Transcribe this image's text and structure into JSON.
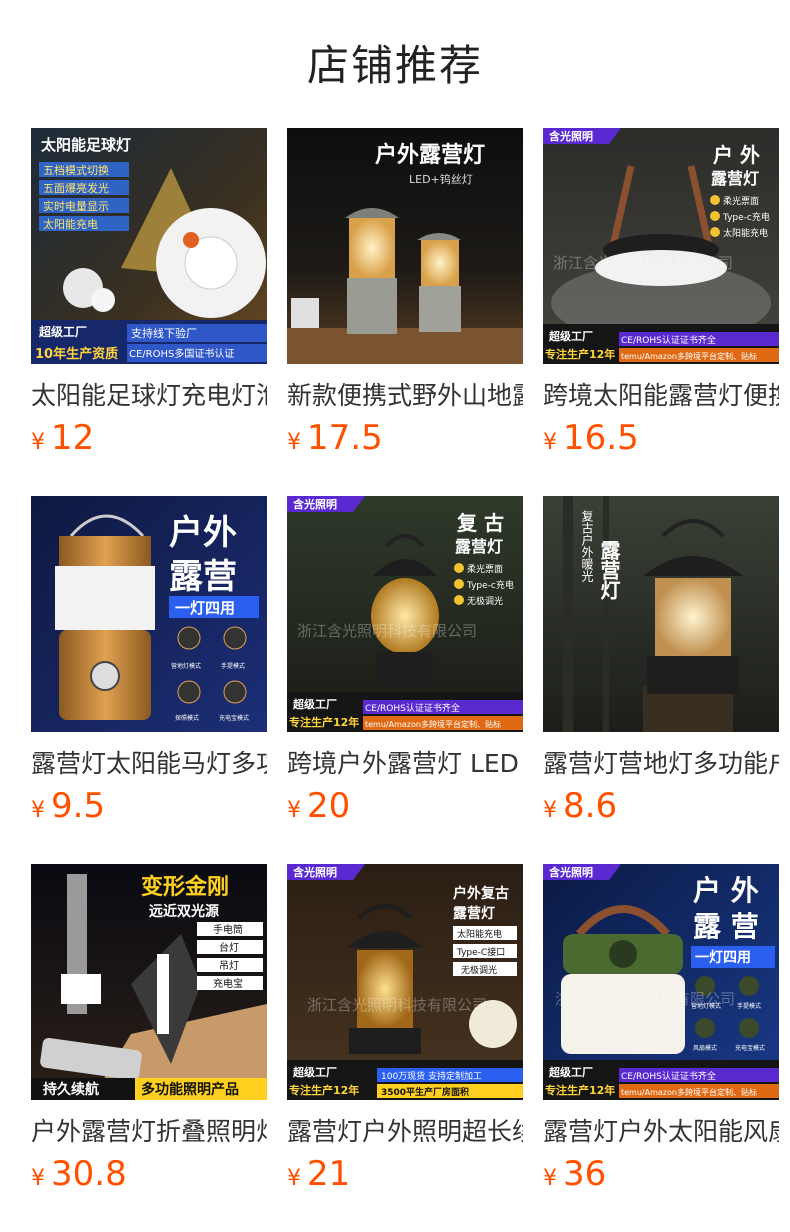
{
  "header": {
    "title": "店铺推荐"
  },
  "colors": {
    "price": "#ff5000",
    "title": "#222222",
    "name": "#333333"
  },
  "products": [
    {
      "name": "太阳能足球灯充电灯泡",
      "currency": "¥",
      "price": "12",
      "image_text": {
        "headline": "太阳能足球灯",
        "bullets": [
          "五档模式切换",
          "五面爆亮发光",
          "实时电量显示",
          "太阳能充电"
        ],
        "badge": "超级工厂",
        "years": "10年生产资质",
        "sub1": "支持线下验厂",
        "sub2": "CE/ROHS多国证书认证"
      }
    },
    {
      "name": "新款便携式野外山地露营灯",
      "currency": "¥",
      "price": "17.5",
      "image_text": {
        "headline": "户外露营灯",
        "sub": "LED+钨丝灯"
      }
    },
    {
      "name": "跨境太阳能露营灯便携式",
      "currency": "¥",
      "price": "16.5",
      "image_text": {
        "brand": "含光照明",
        "headline1": "户 外",
        "headline2": "露营灯",
        "features": [
          "柔光票面",
          "Type-c充电",
          "太阳能充电"
        ],
        "watermark": "浙江含光照明科技有限公司",
        "badge": "超级工厂",
        "years": "专注生产12年",
        "cert": "CE/ROHS认证证书齐全",
        "platform": "temu/Amazon多跨境平台定制、贴标"
      }
    },
    {
      "name": "露营灯太阳能马灯多功能",
      "currency": "¥",
      "price": "9.5",
      "image_text": {
        "headline1": "户外",
        "headline2": "露营",
        "banner": "一灯四用",
        "modes": [
          "营地灯模式",
          "手提模式",
          "探照模式",
          "充电宝模式"
        ]
      }
    },
    {
      "name": "跨境户外露营灯 LED",
      "currency": "¥",
      "price": "20",
      "image_text": {
        "brand": "含光照明",
        "headline1": "复 古",
        "headline2": "露营灯",
        "features": [
          "柔光票面",
          "Type-c充电",
          "无极调光"
        ],
        "watermark": "浙江含光照明科技有限公司",
        "badge": "超级工厂",
        "years": "专注生产12年",
        "cert": "CE/ROHS认证证书齐全",
        "platform": "temu/Amazon多跨境平台定制、贴标"
      }
    },
    {
      "name": "露营灯营地灯多功能户外",
      "currency": "¥",
      "price": "8.6",
      "image_text": {
        "vertical1": "复古户外暖光",
        "vertical2": "露营灯"
      }
    },
    {
      "name": "户外露营灯折叠照明灯",
      "currency": "¥",
      "price": "30.8",
      "image_text": {
        "headline": "变形金刚",
        "sub": "远近双光源",
        "features": [
          "手电筒",
          "台灯",
          "吊灯",
          "充电宝"
        ],
        "left": "持久续航",
        "right": "多功能照明产品"
      }
    },
    {
      "name": "露营灯户外照明超长续航",
      "currency": "¥",
      "price": "21",
      "image_text": {
        "brand": "含光照明",
        "headline1": "户外复古",
        "headline2": "露营灯",
        "features": [
          "太阳能充电",
          "Type-C接口",
          "无极调光"
        ],
        "watermark": "浙江含光照明科技有限公司",
        "badge": "超级工厂",
        "years": "专注生产12年",
        "stock": "100万现货 支持定制加工",
        "area": "3500平生产厂房面积"
      }
    },
    {
      "name": "露营灯户外太阳能风扇灯",
      "currency": "¥",
      "price": "36",
      "image_text": {
        "brand": "含光照明",
        "headline1": "户 外",
        "headline2": "露 营",
        "banner": "一灯四用",
        "modes": [
          "营地灯模式",
          "手提模式",
          "风扇模式",
          "充电宝模式"
        ],
        "watermark": "浙江含光照明科技有限公司",
        "badge": "超级工厂",
        "years": "专注生产12年",
        "cert": "CE/ROHS认证证书齐全",
        "platform": "temu/Amazon多跨境平台定制、贴标"
      }
    }
  ]
}
